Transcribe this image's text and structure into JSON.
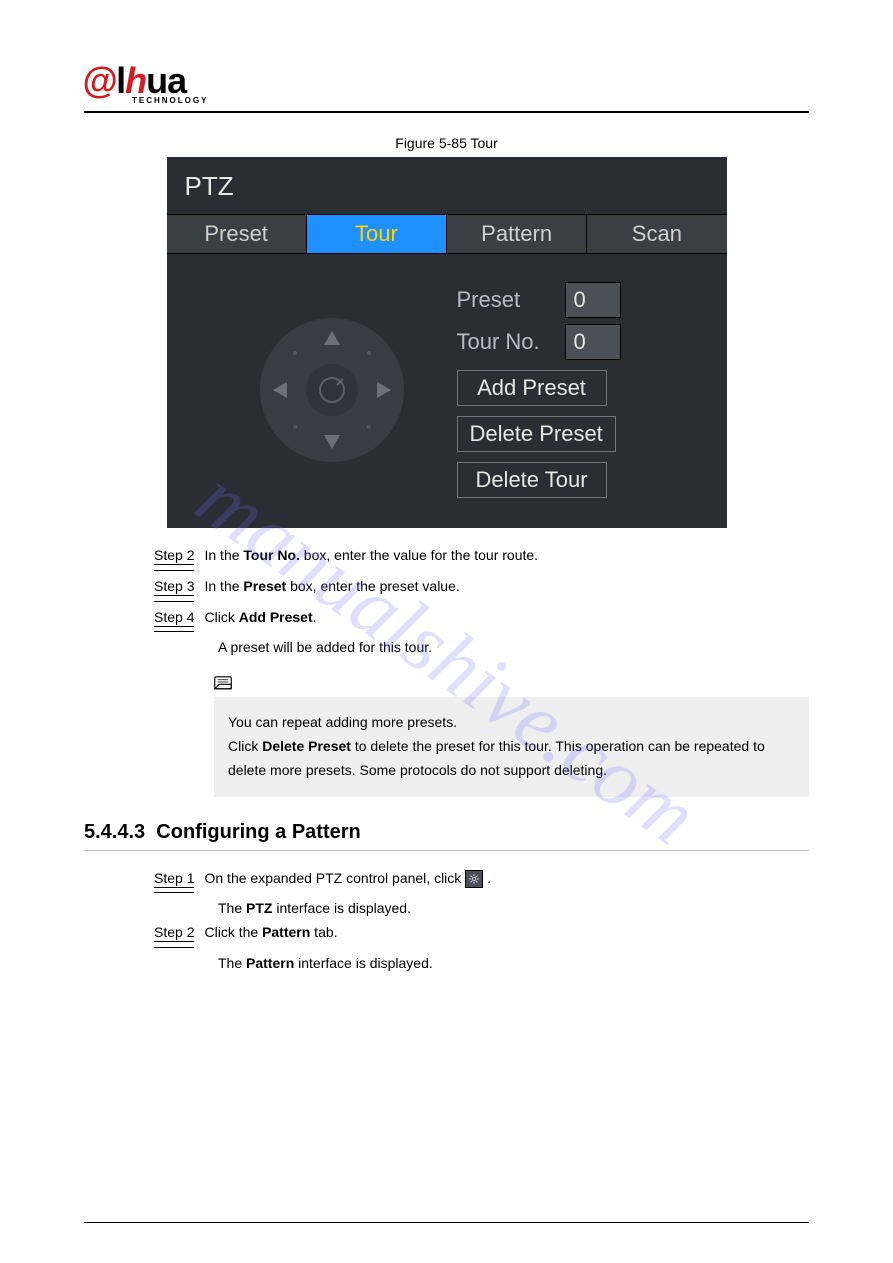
{
  "logo": {
    "prefix": "@",
    "h": "h",
    "rest": "ua",
    "sub": "TECHNOLOGY"
  },
  "figure_caption": "Figure 5-85 Tour",
  "ptz": {
    "title": "PTZ",
    "tabs": {
      "preset": "Preset",
      "tour": "Tour",
      "pattern": "Pattern",
      "scan": "Scan"
    },
    "labels": {
      "preset": "Preset",
      "tourno": "Tour No."
    },
    "values": {
      "preset": "0",
      "tourno": "0"
    },
    "buttons": {
      "add_preset": "Add Preset",
      "delete_preset": "Delete Preset",
      "delete_tour": "Delete Tour"
    }
  },
  "steps": {
    "s2_label": "Step 2",
    "s2_a": "In the ",
    "s2_b": "Tour No.",
    "s2_c": " box, enter the value for the tour route.",
    "s3_label": "Step 3",
    "s3_a": "In the ",
    "s3_b": "Preset",
    "s3_c": " box, enter the preset value.",
    "s4_label": "Step 4",
    "s4_a": "Click ",
    "s4_b": "Add Preset",
    "s4_c": ".",
    "s4_d": "A preset will be added for this tour."
  },
  "note": {
    "l1": "You can repeat adding more presets.",
    "l2_a": "Click ",
    "l2_b": "Delete Preset",
    "l2_c": " to delete the preset for this tour. This operation can be repeated to delete more presets. Some protocols do not support deleting."
  },
  "section": {
    "num": "5.4.4.3",
    "title": "Configuring a Pattern",
    "step1_label": "Step 1",
    "step1_a": "On the expanded PTZ control panel, click ",
    "step1_b": ".",
    "step1_c": "The ",
    "step1_d": "PTZ",
    "step1_e": " interface is displayed.",
    "step2_label": "Step 2",
    "step2_a": "Click the ",
    "step2_b": "Pattern",
    "step2_c": " tab.",
    "step2_d": "The ",
    "step2_e": "Pattern",
    "step2_f": " interface is displayed."
  },
  "watermark": "manualshive.com",
  "pagenum": ""
}
